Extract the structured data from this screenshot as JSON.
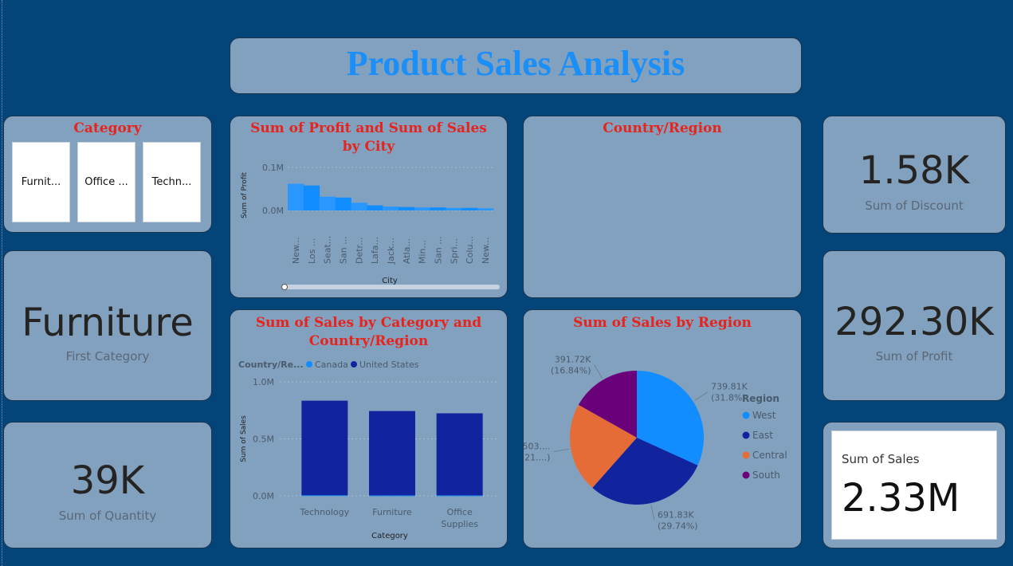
{
  "dashboard": {
    "title": "Product Sales Analysis"
  },
  "slicer": {
    "title": "Category",
    "items": [
      "Furnit...",
      "Office ...",
      "Techn..."
    ]
  },
  "first_category": {
    "value": "Furniture",
    "label": "First Category"
  },
  "quantity": {
    "value": "39K",
    "label": "Sum of Quantity"
  },
  "discount": {
    "value": "1.58K",
    "label": "Sum of Discount"
  },
  "profit": {
    "value": "292.30K",
    "label": "Sum of Profit"
  },
  "sales_card": {
    "label": "Sum of Sales",
    "value": "2.33M"
  },
  "country_region": {
    "title": "Country/Region"
  },
  "colors": {
    "background": "#034479",
    "card": "#81a1bf",
    "title_blue": "#1c8ef7",
    "chart_title_red": "#e8231c",
    "canada": "#118dff",
    "united_states": "#12239e",
    "west": "#118dff",
    "east": "#12239e",
    "central": "#e66c37",
    "south": "#6b007b"
  },
  "chart_data": [
    {
      "type": "area",
      "title": "Sum of Profit and Sum of Sales by City",
      "xlabel": "City",
      "ylabel": "Sum of Profit",
      "ylim": [
        0,
        0.1
      ],
      "yticks": [
        "0.1M",
        "0.0M"
      ],
      "categories": [
        "New...",
        "Los ...",
        "Seat...",
        "San ...",
        "Detr...",
        "Lafa...",
        "Jack...",
        "Atla...",
        "Min...",
        "San ...",
        "Spri...",
        "Colu...",
        "New..."
      ],
      "values": [
        0.062,
        0.058,
        0.032,
        0.03,
        0.018,
        0.012,
        0.009,
        0.008,
        0.007,
        0.007,
        0.006,
        0.006,
        0.005
      ]
    },
    {
      "type": "bar",
      "title": "Sum of Sales by Category and Country/Region",
      "xlabel": "Category",
      "ylabel": "Sum of Sales",
      "legend_title": "Country/Re...",
      "ylim": [
        0,
        1.0
      ],
      "yticks": [
        "1.0M",
        "0.5M",
        "0.0M"
      ],
      "categories": [
        "Technology",
        "Furniture",
        "Office Supplies"
      ],
      "series": [
        {
          "name": "Canada",
          "values": [
            0.005,
            0.004,
            0.004
          ]
        },
        {
          "name": "United States",
          "values": [
            0.83,
            0.74,
            0.72
          ]
        }
      ]
    },
    {
      "type": "pie",
      "title": "Sum of Sales by Region",
      "legend_title": "Region",
      "slices": [
        {
          "name": "West",
          "value": 739.81,
          "label": "739.81K",
          "pct": "(31.8%)"
        },
        {
          "name": "East",
          "value": 691.83,
          "label": "691.83K",
          "pct": "(29.74%)"
        },
        {
          "name": "Central",
          "value": 503.17,
          "label": "503....",
          "pct": "(21....)"
        },
        {
          "name": "South",
          "value": 391.72,
          "label": "391.72K",
          "pct": "(16.84%)"
        }
      ]
    }
  ]
}
